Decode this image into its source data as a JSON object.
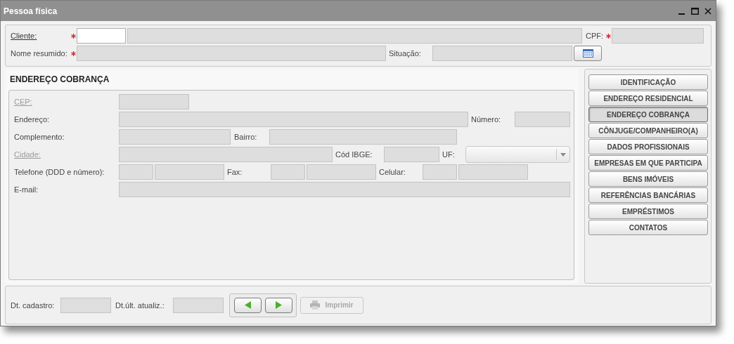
{
  "window": {
    "title": "Pessoa física"
  },
  "header": {
    "cliente": {
      "label": "Cliente:",
      "link": true,
      "required": true,
      "code_disabled": false,
      "name_disabled": true
    },
    "cpf": {
      "label": "CPF:",
      "required": true,
      "disabled": true
    },
    "nome_resumido": {
      "label": "Nome resumido:",
      "required": true,
      "disabled": true
    },
    "situacao": {
      "label": "Situação:",
      "disabled": true
    }
  },
  "section_title": "ENDEREÇO COBRANÇA",
  "address_rows": [
    [
      {
        "kind": "label",
        "text": "CEP:",
        "link": true,
        "disabled": true
      },
      {
        "kind": "field",
        "disabled": true
      }
    ],
    [
      {
        "kind": "label",
        "text": "Endereço:"
      },
      {
        "kind": "field",
        "disabled": true
      },
      {
        "kind": "label",
        "text": "Número:"
      },
      {
        "kind": "field",
        "disabled": true
      }
    ],
    [
      {
        "kind": "label",
        "text": "Complemento:"
      },
      {
        "kind": "field",
        "disabled": true
      },
      {
        "kind": "label",
        "text": "Bairro:"
      },
      {
        "kind": "field",
        "disabled": true
      }
    ],
    [
      {
        "kind": "label",
        "text": "Cidade:",
        "link": true,
        "disabled": true
      },
      {
        "kind": "field",
        "disabled": true
      },
      {
        "kind": "label",
        "text": "Cód IBGE:"
      },
      {
        "kind": "field",
        "disabled": true
      },
      {
        "kind": "label",
        "text": "UF:"
      },
      {
        "kind": "select",
        "disabled": true
      }
    ],
    [
      {
        "kind": "label",
        "text": "Telefone (DDD e número):"
      },
      {
        "kind": "field",
        "disabled": true
      },
      {
        "kind": "field",
        "disabled": true
      },
      {
        "kind": "label",
        "text": "Fax:"
      },
      {
        "kind": "field",
        "disabled": true
      },
      {
        "kind": "field",
        "disabled": true
      },
      {
        "kind": "label",
        "text": "Celular:"
      },
      {
        "kind": "field",
        "disabled": true
      },
      {
        "kind": "field",
        "disabled": true
      }
    ],
    [
      {
        "kind": "label",
        "text": "E-mail:"
      },
      {
        "kind": "field",
        "disabled": true
      }
    ]
  ],
  "tabs": [
    {
      "label": "IDENTIFICAÇÃO",
      "selected": false
    },
    {
      "label": "ENDEREÇO RESIDENCIAL",
      "selected": false
    },
    {
      "label": "ENDEREÇO COBRANÇA",
      "selected": true
    },
    {
      "label": "CÔNJUGE/COMPANHEIRO(A)",
      "selected": false
    },
    {
      "label": "DADOS PROFISSIONAIS",
      "selected": false
    },
    {
      "label": "EMPRESAS EM QUE PARTICIPA",
      "selected": false
    },
    {
      "label": "BENS IMÓVEIS",
      "selected": false
    },
    {
      "label": "REFERÊNCIAS BANCÁRIAS",
      "selected": false
    },
    {
      "label": "EMPRÉSTIMOS",
      "selected": false
    },
    {
      "label": "CONTATOS",
      "selected": false
    }
  ],
  "footer": {
    "dt_cadastro": {
      "label": "Dt. cadastro:",
      "disabled": true
    },
    "dt_atualiz": {
      "label": "Dt.últ. atualiz.:",
      "disabled": true
    },
    "print_button": {
      "label": "Imprimir",
      "disabled": true
    }
  }
}
